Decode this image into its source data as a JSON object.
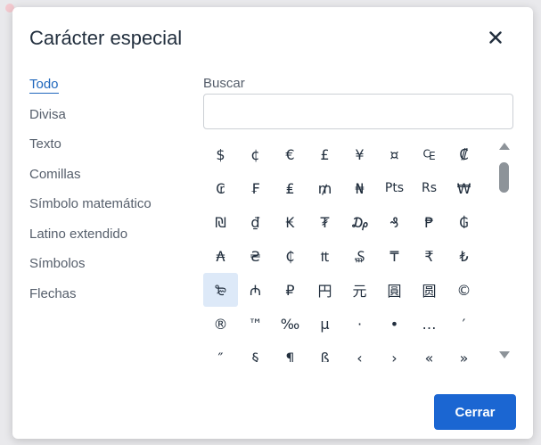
{
  "dialog": {
    "title": "Carácter especial",
    "close_label": "×",
    "confirm_label": "Cerrar"
  },
  "colors": {
    "accent": "#1b66d2",
    "active_link": "#2168bd",
    "selected_cell": "#dde9f8"
  },
  "nav": {
    "items": [
      {
        "label": "Todo",
        "active": true
      },
      {
        "label": "Divisa"
      },
      {
        "label": "Texto"
      },
      {
        "label": "Comillas"
      },
      {
        "label": "Símbolo matemático"
      },
      {
        "label": "Latino extendido"
      },
      {
        "label": "Símbolos"
      },
      {
        "label": "Flechas"
      }
    ]
  },
  "search": {
    "label": "Buscar",
    "value": "",
    "placeholder": ""
  },
  "characters": {
    "selected_index": 32,
    "items": [
      "$",
      "¢",
      "€",
      "£",
      "¥",
      "¤",
      "₠",
      "₡",
      "₢",
      "₣",
      "₤",
      "₥",
      "₦",
      "Pts",
      "Rs",
      "₩",
      "₪",
      "₫",
      "₭",
      "₮",
      "₯",
      "₰",
      "₱",
      "₲",
      "₳",
      "₴",
      "₵",
      "₶",
      "₷",
      "₸",
      "₹",
      "₺",
      "₻",
      "₼",
      "₽",
      "円",
      "元",
      "圓",
      "圆",
      "©",
      "®",
      "™",
      "‰",
      "µ",
      "·",
      "•",
      "…",
      "′",
      "″",
      "§",
      "¶",
      "ß",
      "‹",
      "›",
      "«",
      "»"
    ]
  }
}
